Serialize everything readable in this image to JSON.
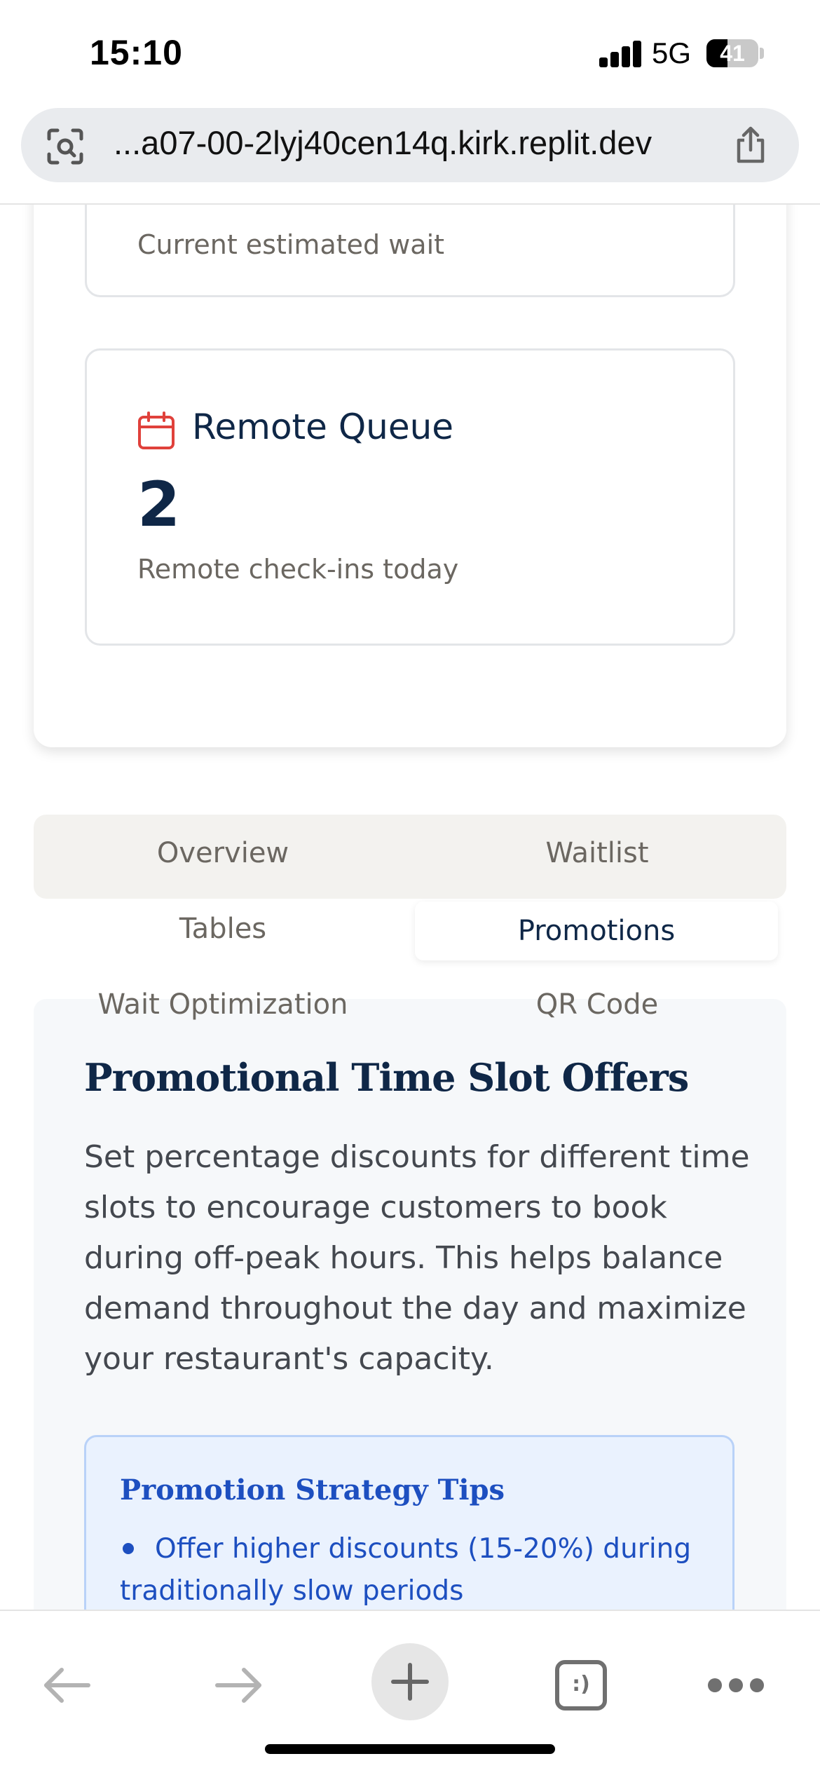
{
  "status_bar": {
    "time": "15:10",
    "network": "5G",
    "battery_level": "41",
    "battery_fraction": 0.41,
    "signal_icon": "signal-bars-icon"
  },
  "browser": {
    "url": "...a07-00-2lyj40cen14q.kirk.replit.dev",
    "left_icon": "page-search-icon",
    "right_icon": "share-icon"
  },
  "cards": {
    "wait_subtitle": "Current estimated wait",
    "remote_queue": {
      "title": "Remote Queue",
      "value": "2",
      "subtitle": "Remote check-ins today",
      "icon": "calendar-icon",
      "icon_color": "#e0413b"
    }
  },
  "tabs": {
    "overview": "Overview",
    "waitlist": "Waitlist",
    "tables": "Tables",
    "promotions": "Promotions",
    "wait_optimization": "Wait Optimization",
    "qr_code": "QR Code",
    "active": "Promotions"
  },
  "promotions": {
    "title": "Promotional Time Slot Offers",
    "description": "Set percentage discounts for different time slots to encourage customers to book during off-peak hours. This helps balance demand throughout the day and maximize your restaurant's capacity.",
    "tips": {
      "title": "Promotion Strategy Tips",
      "items": [
        "Offer higher discounts (15-20%) during traditionally slow periods"
      ]
    }
  },
  "bottom_toolbar": {
    "back_icon": "back-arrow-icon",
    "forward_icon": "forward-arrow-icon",
    "new_tab_icon": "plus-icon",
    "tabs_label": ":)",
    "more_icon": "more-dots-icon"
  },
  "colors": {
    "navy": "#0f2747",
    "muted": "#6b6761",
    "tip_blue": "#1d4fc0",
    "tip_bg": "#eaf2fe",
    "accent_red": "#e0413b"
  }
}
